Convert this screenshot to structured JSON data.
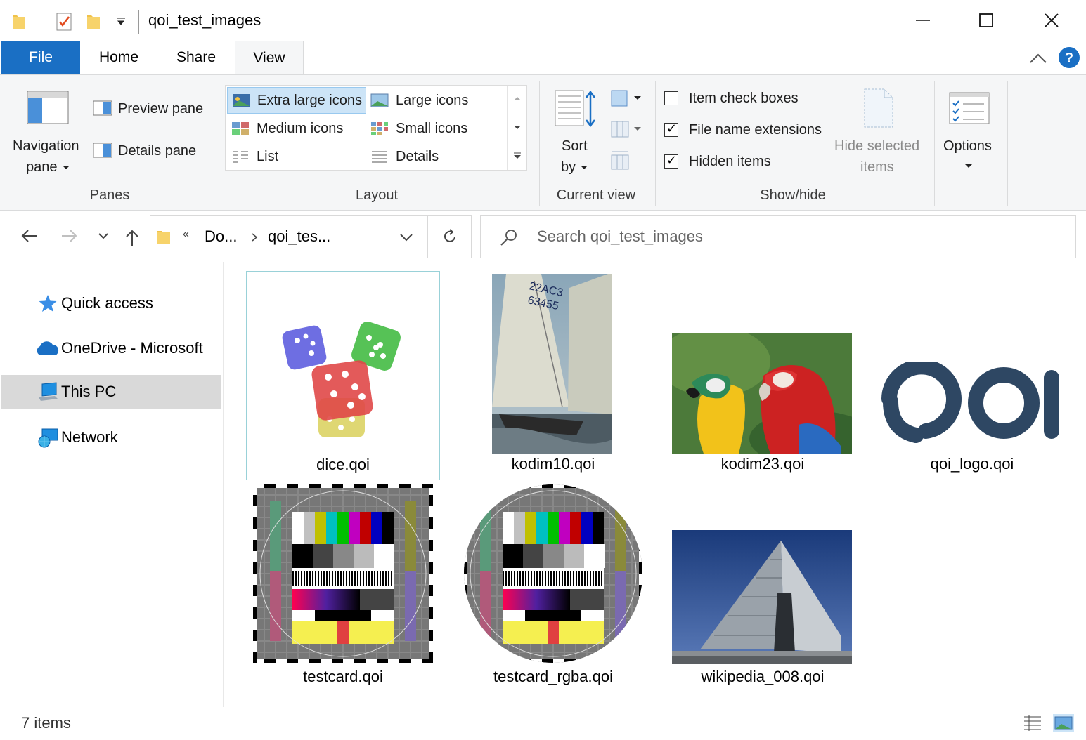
{
  "window": {
    "title": "qoi_test_images",
    "minimize_icon": "minimize-icon",
    "maximize_icon": "maximize-icon",
    "close_icon": "close-icon"
  },
  "ribbon_tabs": [
    {
      "label": "File"
    },
    {
      "label": "Home"
    },
    {
      "label": "Share"
    },
    {
      "label": "View"
    }
  ],
  "ribbon": {
    "panes": {
      "navigation_pane_line1": "Navigation",
      "navigation_pane_line2": "pane",
      "preview_pane": "Preview pane",
      "details_pane": "Details pane",
      "group_label": "Panes"
    },
    "layout": {
      "items": [
        {
          "label": "Extra large icons",
          "selected": true
        },
        {
          "label": "Large icons"
        },
        {
          "label": "Medium icons"
        },
        {
          "label": "Small icons"
        },
        {
          "label": "List"
        },
        {
          "label": "Details"
        }
      ],
      "group_label": "Layout"
    },
    "current_view": {
      "sort_line1": "Sort",
      "sort_line2": "by",
      "group_label": "Current view"
    },
    "show_hide": {
      "item_check_boxes": {
        "label": "Item check boxes",
        "checked": false
      },
      "file_name_extensions": {
        "label": "File name extensions",
        "checked": true
      },
      "hidden_items": {
        "label": "Hidden items",
        "checked": true
      },
      "hide_selected_line1": "Hide selected",
      "hide_selected_line2": "items",
      "group_label": "Show/hide"
    },
    "options": {
      "label": "Options"
    }
  },
  "address": {
    "overflow": "«",
    "crumbs": [
      "Do...",
      "qoi_tes..."
    ],
    "search_placeholder": "Search qoi_test_images"
  },
  "nav_pane": [
    {
      "label": "Quick access",
      "icon": "star-icon"
    },
    {
      "label": "OneDrive - Microsoft",
      "icon": "cloud-icon"
    },
    {
      "label": "This PC",
      "icon": "computer-icon",
      "selected": true
    },
    {
      "label": "Network",
      "icon": "network-icon"
    }
  ],
  "files": [
    {
      "name": "dice.qoi",
      "selected": true
    },
    {
      "name": "kodim10.qoi"
    },
    {
      "name": "kodim23.qoi"
    },
    {
      "name": "qoi_logo.qoi"
    },
    {
      "name": "testcard.qoi"
    },
    {
      "name": "testcard_rgba.qoi"
    },
    {
      "name": "wikipedia_008.qoi"
    }
  ],
  "logo_text": "QOI",
  "status": {
    "count": "7 items"
  }
}
